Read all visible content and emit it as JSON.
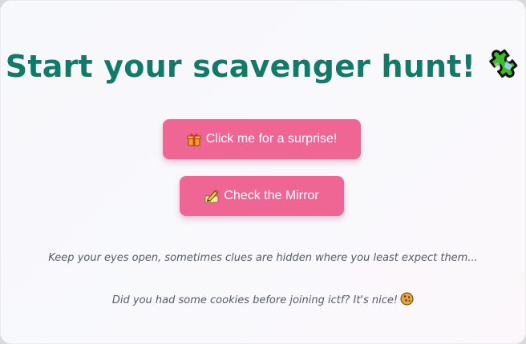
{
  "page": {
    "title": "Start your scavenger hunt!",
    "title_icon": "puzzle-piece-icon",
    "buttons": {
      "surprise": {
        "label": "Click me for a surprise!",
        "icon": "gift-icon"
      },
      "mirror": {
        "label": "Check the Mirror",
        "icon": "pencil-icon"
      }
    },
    "hint": "Keep your eyes open, sometimes clues are hidden where you least expect them...",
    "cookie_note": "Did you had some cookies before joining ictf? It's nice!",
    "cookie_icon": "cookie-icon"
  },
  "colors": {
    "title": "#117a69",
    "button_bg": "#ef6695",
    "button_text": "#ffffff",
    "note_text": "#555a66"
  }
}
